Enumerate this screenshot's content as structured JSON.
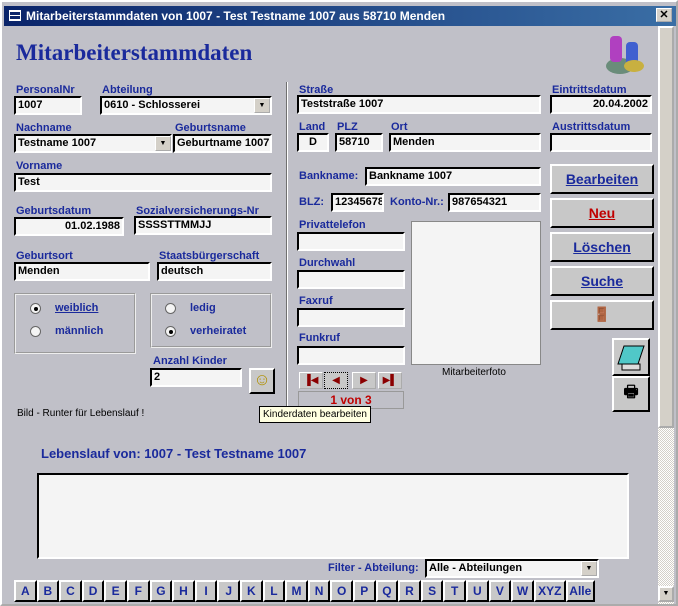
{
  "window": {
    "title": "Mitarbeiterstammdaten von 1007 - Test Testname 1007 aus 58710 Menden",
    "close": "✕"
  },
  "header": {
    "title": "Mitarbeiterstammdaten"
  },
  "fields": {
    "personalnr": {
      "label": "PersonalNr",
      "value": "1007"
    },
    "abteilung": {
      "label": "Abteilung",
      "value": "0610 - Schlosserei"
    },
    "nachname": {
      "label": "Nachname",
      "value": "Testname 1007"
    },
    "geburtsname": {
      "label": "Geburtsname",
      "value": "Geburtname 1007"
    },
    "vorname": {
      "label": "Vorname",
      "value": "Test"
    },
    "geburtsdatum": {
      "label": "Geburtsdatum",
      "value": "01.02.1988"
    },
    "sozvers": {
      "label": "Sozialversicherungs-Nr",
      "value": "SSSSTTMMJJ"
    },
    "geburtsort": {
      "label": "Geburtsort",
      "value": "Menden"
    },
    "staatsbuergerschaft": {
      "label": "Staatsbürgerschaft",
      "value": "deutsch"
    },
    "anzahl_kinder": {
      "label": "Anzahl Kinder",
      "value": "2"
    },
    "strasse": {
      "label": "Straße",
      "value": "Teststraße 1007"
    },
    "land": {
      "label": "Land",
      "value": "D"
    },
    "plz": {
      "label": "PLZ",
      "value": "58710"
    },
    "ort": {
      "label": "Ort",
      "value": "Menden"
    },
    "bankname": {
      "label": "Bankname:",
      "value": "Bankname 1007"
    },
    "blz": {
      "label": "BLZ:",
      "value": "12345678"
    },
    "konto": {
      "label": "Konto-Nr.:",
      "value": "987654321"
    },
    "privattelefon": {
      "label": "Privattelefon",
      "value": ""
    },
    "durchwahl": {
      "label": "Durchwahl",
      "value": ""
    },
    "faxruf": {
      "label": "Faxruf",
      "value": ""
    },
    "funkruf": {
      "label": "Funkruf",
      "value": ""
    },
    "eintrittsdatum": {
      "label": "Eintrittsdatum",
      "value": "20.04.2002"
    },
    "austrittsdatum": {
      "label": "Austrittsdatum",
      "value": ""
    }
  },
  "gender": {
    "options": [
      "weiblich",
      "männlich"
    ],
    "selected": "weiblich"
  },
  "marital": {
    "options": [
      "ledig",
      "verheiratet"
    ],
    "selected": "verheiratet"
  },
  "photo": {
    "caption": "Mitarbeiterfoto"
  },
  "record_nav": {
    "counter": "1 von 3"
  },
  "buttons": {
    "bearbeiten": "Bearbeiten",
    "neu": "Neu",
    "loeschen": "Löschen",
    "suche": "Suche"
  },
  "tooltip": "Kinderdaten bearbeiten",
  "hint": "Bild - Runter für Lebenslauf !",
  "lebenslauf": {
    "title": "Lebenslauf von: 1007 - Test Testname 1007",
    "value": ""
  },
  "filter": {
    "label": "Filter - Abteilung:",
    "value": "Alle - Abteilungen"
  },
  "alphabet": [
    "A",
    "B",
    "C",
    "D",
    "E",
    "F",
    "G",
    "H",
    "I",
    "J",
    "K",
    "L",
    "M",
    "N",
    "O",
    "P",
    "Q",
    "R",
    "S",
    "T",
    "U",
    "V",
    "W",
    "XYZ",
    "Alle"
  ],
  "colors": {
    "label": "#1a2a9c",
    "title": "#1a2a9c",
    "neu": "#c00000",
    "background": "#c0c0c8"
  }
}
